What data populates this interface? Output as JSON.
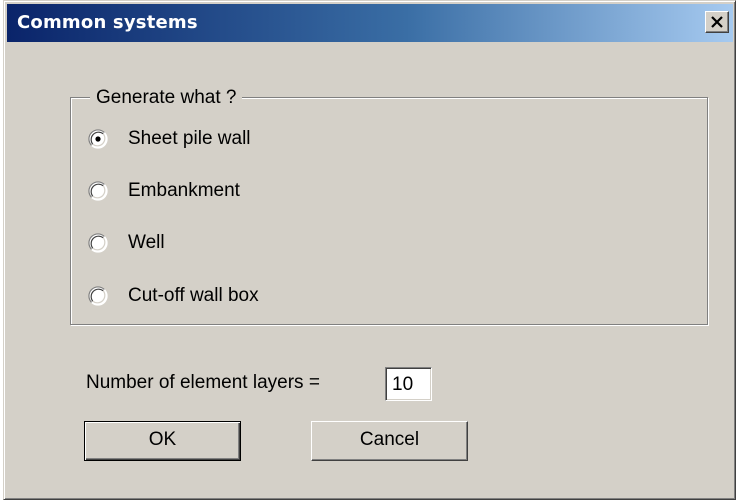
{
  "window": {
    "title": "Common systems",
    "close_icon": "close-icon"
  },
  "group": {
    "legend": "Generate what ?",
    "options": [
      {
        "label": "Sheet pile wall",
        "selected": true
      },
      {
        "label": "Embankment",
        "selected": false
      },
      {
        "label": "Well",
        "selected": false
      },
      {
        "label": "Cut-off wall box",
        "selected": false
      }
    ]
  },
  "layers": {
    "label": "Number of element layers =",
    "value": "10"
  },
  "buttons": {
    "ok_label": "OK",
    "cancel_label": "Cancel"
  },
  "colors": {
    "dialog_face": "#d4d0c8",
    "title_gradient_start": "#0a246a",
    "title_gradient_end": "#a6caf0"
  }
}
